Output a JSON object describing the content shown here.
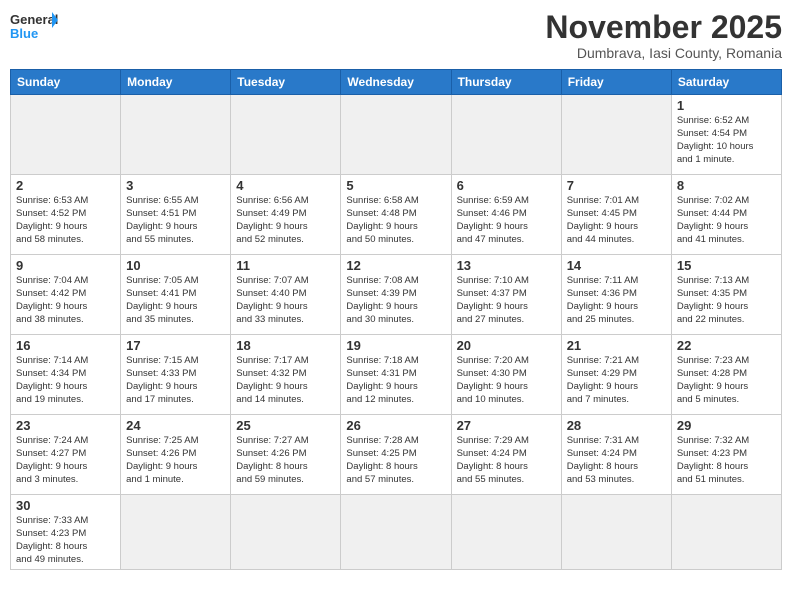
{
  "header": {
    "logo_general": "General",
    "logo_blue": "Blue",
    "month_title": "November 2025",
    "location": "Dumbrava, Iasi County, Romania"
  },
  "weekdays": [
    "Sunday",
    "Monday",
    "Tuesday",
    "Wednesday",
    "Thursday",
    "Friday",
    "Saturday"
  ],
  "weeks": [
    [
      {
        "day": "",
        "info": ""
      },
      {
        "day": "",
        "info": ""
      },
      {
        "day": "",
        "info": ""
      },
      {
        "day": "",
        "info": ""
      },
      {
        "day": "",
        "info": ""
      },
      {
        "day": "",
        "info": ""
      },
      {
        "day": "1",
        "info": "Sunrise: 6:52 AM\nSunset: 4:54 PM\nDaylight: 10 hours\nand 1 minute."
      }
    ],
    [
      {
        "day": "2",
        "info": "Sunrise: 6:53 AM\nSunset: 4:52 PM\nDaylight: 9 hours\nand 58 minutes."
      },
      {
        "day": "3",
        "info": "Sunrise: 6:55 AM\nSunset: 4:51 PM\nDaylight: 9 hours\nand 55 minutes."
      },
      {
        "day": "4",
        "info": "Sunrise: 6:56 AM\nSunset: 4:49 PM\nDaylight: 9 hours\nand 52 minutes."
      },
      {
        "day": "5",
        "info": "Sunrise: 6:58 AM\nSunset: 4:48 PM\nDaylight: 9 hours\nand 50 minutes."
      },
      {
        "day": "6",
        "info": "Sunrise: 6:59 AM\nSunset: 4:46 PM\nDaylight: 9 hours\nand 47 minutes."
      },
      {
        "day": "7",
        "info": "Sunrise: 7:01 AM\nSunset: 4:45 PM\nDaylight: 9 hours\nand 44 minutes."
      },
      {
        "day": "8",
        "info": "Sunrise: 7:02 AM\nSunset: 4:44 PM\nDaylight: 9 hours\nand 41 minutes."
      }
    ],
    [
      {
        "day": "9",
        "info": "Sunrise: 7:04 AM\nSunset: 4:42 PM\nDaylight: 9 hours\nand 38 minutes."
      },
      {
        "day": "10",
        "info": "Sunrise: 7:05 AM\nSunset: 4:41 PM\nDaylight: 9 hours\nand 35 minutes."
      },
      {
        "day": "11",
        "info": "Sunrise: 7:07 AM\nSunset: 4:40 PM\nDaylight: 9 hours\nand 33 minutes."
      },
      {
        "day": "12",
        "info": "Sunrise: 7:08 AM\nSunset: 4:39 PM\nDaylight: 9 hours\nand 30 minutes."
      },
      {
        "day": "13",
        "info": "Sunrise: 7:10 AM\nSunset: 4:37 PM\nDaylight: 9 hours\nand 27 minutes."
      },
      {
        "day": "14",
        "info": "Sunrise: 7:11 AM\nSunset: 4:36 PM\nDaylight: 9 hours\nand 25 minutes."
      },
      {
        "day": "15",
        "info": "Sunrise: 7:13 AM\nSunset: 4:35 PM\nDaylight: 9 hours\nand 22 minutes."
      }
    ],
    [
      {
        "day": "16",
        "info": "Sunrise: 7:14 AM\nSunset: 4:34 PM\nDaylight: 9 hours\nand 19 minutes."
      },
      {
        "day": "17",
        "info": "Sunrise: 7:15 AM\nSunset: 4:33 PM\nDaylight: 9 hours\nand 17 minutes."
      },
      {
        "day": "18",
        "info": "Sunrise: 7:17 AM\nSunset: 4:32 PM\nDaylight: 9 hours\nand 14 minutes."
      },
      {
        "day": "19",
        "info": "Sunrise: 7:18 AM\nSunset: 4:31 PM\nDaylight: 9 hours\nand 12 minutes."
      },
      {
        "day": "20",
        "info": "Sunrise: 7:20 AM\nSunset: 4:30 PM\nDaylight: 9 hours\nand 10 minutes."
      },
      {
        "day": "21",
        "info": "Sunrise: 7:21 AM\nSunset: 4:29 PM\nDaylight: 9 hours\nand 7 minutes."
      },
      {
        "day": "22",
        "info": "Sunrise: 7:23 AM\nSunset: 4:28 PM\nDaylight: 9 hours\nand 5 minutes."
      }
    ],
    [
      {
        "day": "23",
        "info": "Sunrise: 7:24 AM\nSunset: 4:27 PM\nDaylight: 9 hours\nand 3 minutes."
      },
      {
        "day": "24",
        "info": "Sunrise: 7:25 AM\nSunset: 4:26 PM\nDaylight: 9 hours\nand 1 minute."
      },
      {
        "day": "25",
        "info": "Sunrise: 7:27 AM\nSunset: 4:26 PM\nDaylight: 8 hours\nand 59 minutes."
      },
      {
        "day": "26",
        "info": "Sunrise: 7:28 AM\nSunset: 4:25 PM\nDaylight: 8 hours\nand 57 minutes."
      },
      {
        "day": "27",
        "info": "Sunrise: 7:29 AM\nSunset: 4:24 PM\nDaylight: 8 hours\nand 55 minutes."
      },
      {
        "day": "28",
        "info": "Sunrise: 7:31 AM\nSunset: 4:24 PM\nDaylight: 8 hours\nand 53 minutes."
      },
      {
        "day": "29",
        "info": "Sunrise: 7:32 AM\nSunset: 4:23 PM\nDaylight: 8 hours\nand 51 minutes."
      }
    ],
    [
      {
        "day": "30",
        "info": "Sunrise: 7:33 AM\nSunset: 4:23 PM\nDaylight: 8 hours\nand 49 minutes."
      },
      {
        "day": "",
        "info": ""
      },
      {
        "day": "",
        "info": ""
      },
      {
        "day": "",
        "info": ""
      },
      {
        "day": "",
        "info": ""
      },
      {
        "day": "",
        "info": ""
      },
      {
        "day": "",
        "info": ""
      }
    ]
  ]
}
